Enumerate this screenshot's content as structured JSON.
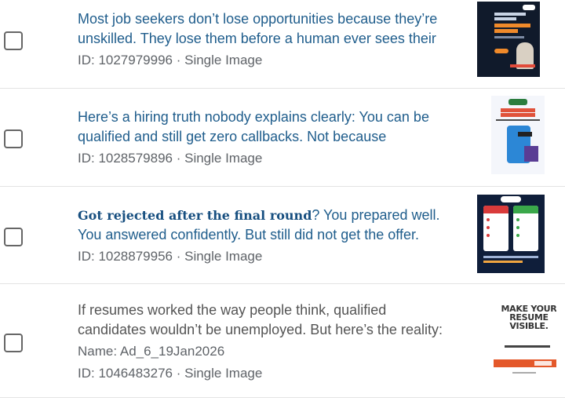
{
  "items": [
    {
      "title_line1": "Most job seekers don’t lose opportunities because they’re",
      "title_line2": "unskilled. They lose them before a human ever sees their",
      "id_line": "ID: 1027979996 · Single Image",
      "thumbnail_icon": "ad-thumbnail-ats-ready"
    },
    {
      "title_line1": "Here’s a hiring truth nobody explains clearly: You can be",
      "title_line2": "qualified and still get zero callbacks. Not because",
      "id_line": "ID: 1028579896 · Single Image",
      "thumbnail_icon": "ad-thumbnail-resume-to-offer"
    },
    {
      "title_bold": "Got rejected after the final round",
      "title_line1_rest": "? You prepared well.",
      "title_line2": "You answered confidently. But still did not get the offer.",
      "id_line": "ID: 1028879956 · Single Image",
      "thumbnail_icon": "ad-thumbnail-interview-prep"
    },
    {
      "title_line1": "If resumes worked the way people think, qualified",
      "title_line2": "candidates wouldn’t be unemployed. But here’s the reality:",
      "name_line": "Name: Ad_6_19Jan2026",
      "id_line": "ID: 1046483276 · Single Image",
      "thumbnail_icon": "ad-thumbnail-make-resume-visible",
      "thumbnail_text": "MAKE YOUR RESUME VISIBLE."
    }
  ],
  "colors": {
    "title_blue": "#1f5d8c",
    "title_grey": "#555555",
    "meta_grey": "#5f6368",
    "divider": "#e3e3e3"
  }
}
